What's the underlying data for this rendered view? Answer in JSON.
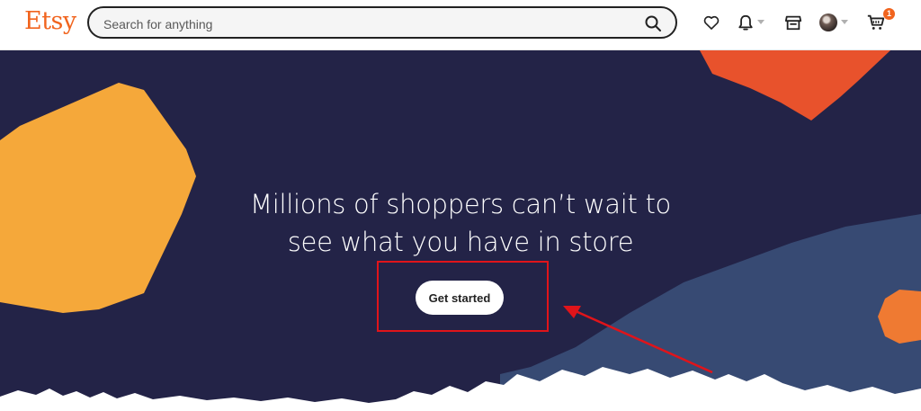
{
  "header": {
    "logo": "Etsy",
    "search": {
      "placeholder": "Search for anything",
      "value": ""
    },
    "icons": [
      "heart-icon",
      "bell-icon",
      "shop-icon",
      "avatar",
      "cart-icon"
    ],
    "cart_count": "1"
  },
  "hero": {
    "headline_line1": "Millions of shoppers can’t wait to",
    "headline_line2": "see what you have in store",
    "cta_label": "Get started"
  },
  "colors": {
    "brand": "#f1641e",
    "hero_bg": "#232347",
    "annotation": "#e0141a",
    "shape_yellow": "#f5a83a",
    "shape_orange": "#e8522c",
    "shape_blue": "#374a73"
  }
}
